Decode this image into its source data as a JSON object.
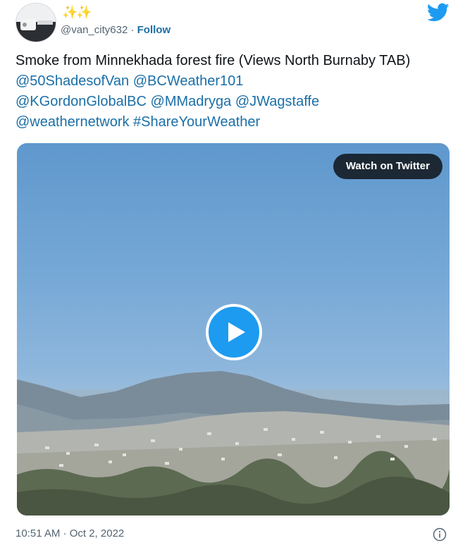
{
  "header": {
    "handle": "@van_city632",
    "separator": "·",
    "follow_label": "Follow",
    "sparkles": "✨✨",
    "avatar_icon": "user-avatar-icon",
    "brand_icon": "twitter-bird-icon",
    "brand_color": "#1d9bf0"
  },
  "tweet": {
    "text_parts": [
      "Smoke from Minnekhada forest fire (Views North Burnaby TAB) ",
      "@50ShadesofVan",
      " ",
      "@BCWeather101",
      " ",
      "@KGordonGlobalBC",
      " ",
      "@MMadryga",
      " ",
      "@JWagstaffe",
      " ",
      "@weathernetwork",
      " ",
      "#ShareYourWeather"
    ],
    "link_color": "#1b6fa7"
  },
  "media": {
    "watch_label": "Watch on Twitter",
    "play_icon": "play-icon"
  },
  "footer": {
    "timestamp": "10:51 AM · Oct 2, 2022",
    "info_icon": "info-icon"
  }
}
